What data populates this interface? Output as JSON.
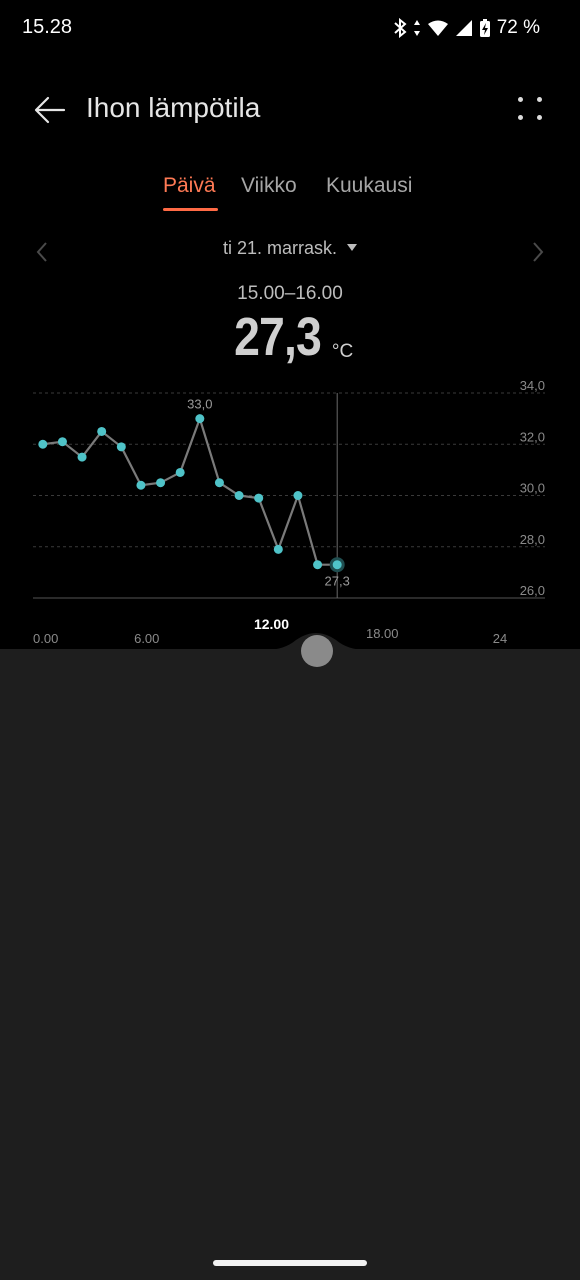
{
  "status_bar": {
    "time": "15.28",
    "battery": "72 %",
    "icons": [
      "bluetooth-icon",
      "data-arrows-icon",
      "wifi-icon",
      "cell-signal-icon",
      "battery-charging-icon"
    ]
  },
  "app_bar": {
    "title": "Ihon lämpötila",
    "back_icon": "back-arrow-icon",
    "more_icon": "more-dots-icon"
  },
  "tabs": [
    {
      "label": "Päivä",
      "active": true
    },
    {
      "label": "Viikko",
      "active": false
    },
    {
      "label": "Kuukausi",
      "active": false
    }
  ],
  "date_nav": {
    "date": "ti 21. marrask.",
    "prev_icon": "chevron-left-icon",
    "next_icon": "chevron-right-icon",
    "dropdown_icon": "dropdown-triangle-icon"
  },
  "reading": {
    "time_range": "15.00–16.00",
    "value": "27,3",
    "unit": "°C"
  },
  "colors": {
    "accent": "#ff7a55",
    "point": "#4fc3c8",
    "line": "#7a7a7a",
    "sheet": "#1e1e1e"
  },
  "chart_data": {
    "type": "line",
    "x_ticks": [
      "0.00",
      "6.00",
      "12.00",
      "18.00",
      "24"
    ],
    "y_ticks": [
      "34,0",
      "32,0",
      "30,0",
      "28,0",
      "26,0"
    ],
    "xlim": [
      0,
      24
    ],
    "ylim": [
      26,
      34
    ],
    "grid": true,
    "series": [
      {
        "x": [
          0.5,
          1.5,
          2.5,
          3.5,
          4.5,
          5.5,
          6.5,
          7.5,
          8.5,
          9.5,
          10.5,
          11.5,
          12.5,
          13.5,
          14.5,
          15.5
        ],
        "y": [
          32.0,
          32.1,
          31.5,
          32.5,
          31.9,
          30.4,
          30.5,
          30.9,
          33.0,
          30.5,
          30.0,
          29.9,
          27.9,
          30.0,
          27.3,
          27.3
        ]
      }
    ],
    "annotations": [
      {
        "x": 8.5,
        "y": 33.0,
        "label": "33,0"
      },
      {
        "x": 15.5,
        "y": 27.3,
        "label": "27,3"
      }
    ],
    "selected_x": 15.5,
    "highlight_tick": "12.00"
  },
  "scrub_handle": "scrub-handle"
}
